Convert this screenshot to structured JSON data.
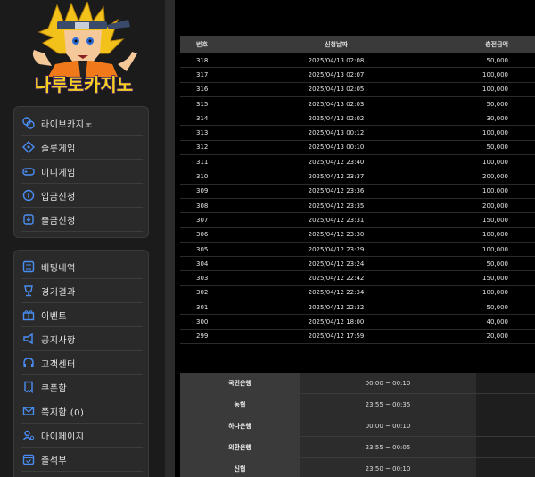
{
  "logo_text": "나루토카지노",
  "menu_group_1": [
    {
      "label": "라이브카지노",
      "icon": "casino-chip-icon"
    },
    {
      "label": "슬롯게임",
      "icon": "slot-icon"
    },
    {
      "label": "미니게임",
      "icon": "gamepad-icon"
    },
    {
      "label": "입금신청",
      "icon": "deposit-icon"
    },
    {
      "label": "출금신청",
      "icon": "withdraw-icon"
    }
  ],
  "menu_group_2": [
    {
      "label": "배팅내역",
      "icon": "list-icon"
    },
    {
      "label": "경기결과",
      "icon": "trophy-icon"
    },
    {
      "label": "이벤트",
      "icon": "gift-icon"
    },
    {
      "label": "공지사항",
      "icon": "megaphone-icon"
    },
    {
      "label": "고객센터",
      "icon": "headset-icon"
    },
    {
      "label": "쿠폰함",
      "icon": "coupon-icon"
    },
    {
      "label": "쪽지함 (0)",
      "icon": "mail-icon"
    },
    {
      "label": "마이페이지",
      "icon": "user-icon"
    },
    {
      "label": "출석부",
      "icon": "calendar-icon"
    }
  ],
  "history": {
    "headers": [
      "번호",
      "신청날짜",
      "충전금액"
    ],
    "rows": [
      [
        "318",
        "2025/04/13 02:08",
        "50,000"
      ],
      [
        "317",
        "2025/04/13 02:07",
        "100,000"
      ],
      [
        "316",
        "2025/04/13 02:05",
        "100,000"
      ],
      [
        "315",
        "2025/04/13 02:03",
        "50,000"
      ],
      [
        "314",
        "2025/04/13 02:02",
        "30,000"
      ],
      [
        "313",
        "2025/04/13 00:12",
        "100,000"
      ],
      [
        "312",
        "2025/04/13 00:10",
        "50,000"
      ],
      [
        "311",
        "2025/04/12 23:40",
        "100,000"
      ],
      [
        "310",
        "2025/04/12 23:37",
        "200,000"
      ],
      [
        "309",
        "2025/04/12 23:36",
        "100,000"
      ],
      [
        "308",
        "2025/04/12 23:35",
        "200,000"
      ],
      [
        "307",
        "2025/04/12 23:31",
        "150,000"
      ],
      [
        "306",
        "2025/04/12 23:30",
        "100,000"
      ],
      [
        "305",
        "2025/04/12 23:29",
        "100,000"
      ],
      [
        "304",
        "2025/04/12 23:24",
        "50,000"
      ],
      [
        "303",
        "2025/04/12 22:42",
        "150,000"
      ],
      [
        "302",
        "2025/04/12 22:34",
        "100,000"
      ],
      [
        "301",
        "2025/04/12 22:32",
        "50,000"
      ],
      [
        "300",
        "2025/04/12 18:00",
        "40,000"
      ],
      [
        "299",
        "2025/04/12 17:59",
        "20,000"
      ]
    ]
  },
  "banks": [
    {
      "name": "국민은행",
      "time": "00:00 ~ 00:10"
    },
    {
      "name": "농협",
      "time": "23:55 ~ 00:35"
    },
    {
      "name": "하나은행",
      "time": "00:00 ~ 00:10"
    },
    {
      "name": "외환은행",
      "time": "23:55 ~ 00:05"
    },
    {
      "name": "신협",
      "time": "23:50 ~ 00:10"
    }
  ]
}
